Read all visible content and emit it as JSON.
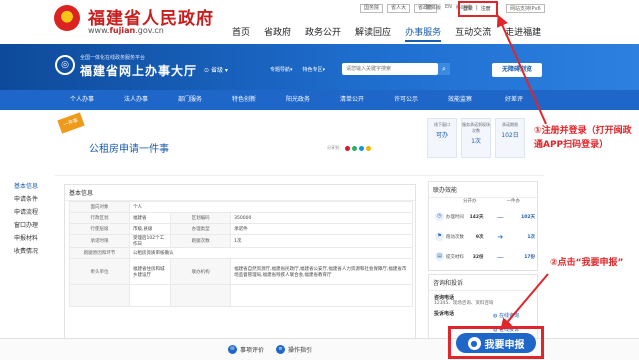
{
  "header": {
    "site_title": "福建省人民政府",
    "site_url_prefix": "www.",
    "site_url_domain": "fujian",
    "site_url_suffix": ".gov.cn",
    "mini_links": [
      "国务院",
      "省人大",
      "省政协"
    ],
    "utility": [
      "繁体版",
      "EN",
      "移动版"
    ],
    "login_label": "登录",
    "register_label": "注册",
    "elder_mode": "网站支持IPv6",
    "nav": [
      "首页",
      "省政府",
      "政务公开",
      "解读回应",
      "办事服务",
      "互动交流",
      "走进福建"
    ],
    "nav_active": 4
  },
  "hall": {
    "subtitle": "全国一体化在线政务服务平台",
    "title": "福建省网上办事大厅",
    "region": "省级",
    "links": [
      "专题导航",
      "特色专区"
    ],
    "search_placeholder": "请您输入关键字搜索",
    "barrier_free": "无障碍浏览"
  },
  "subnav": [
    "个人办事",
    "法人办事",
    "部门服务",
    "特色创新",
    "阳光政务",
    "清单公开",
    "许可公示",
    "效能监察",
    "好差评"
  ],
  "item": {
    "ribbon": "一件事",
    "title": "公租房申请一件事",
    "share_label": "分享到：",
    "stats": [
      {
        "label": "线下窗口",
        "value": "可办"
      },
      {
        "label": "服务承诺到现场次数",
        "value": "1次"
      },
      {
        "label": "承诺期限",
        "value": "102日"
      }
    ]
  },
  "left_menu": [
    "基本信息",
    "申请条件",
    "申请流程",
    "窗口办理",
    "申报材料",
    "收费情况"
  ],
  "left_menu_active": 0,
  "basic_info": {
    "title": "基本信息",
    "rows": [
      {
        "k1": "面向对象",
        "v1": "个人",
        "k2": "",
        "v2": ""
      },
      {
        "k1": "行政区划",
        "v1": "福建省",
        "k2": "区划编码",
        "v2": "350000"
      },
      {
        "k1": "行使层级",
        "v1": "市级,县级",
        "k2": "办理类型",
        "v2": "承诺件"
      },
      {
        "k1": "承诺时限",
        "v1": "受理后102个工作日",
        "k2": "跑腿次数",
        "v2": "1次"
      },
      {
        "k1": "跑腿原因和环节",
        "v1": "公租房资质审核确认",
        "k2": "",
        "v2": ""
      },
      {
        "k1": "牵头单位",
        "v1": "福建省住房和城乡建设厅",
        "k2": "联办机构",
        "v2": "福建省自然资源厅,福建省民政厅,福建省公安厅,福建省人力资源和社会保障厅,福建省市场监督管理局,福建省残疾人联合会,福建省教育厅"
      },
      {
        "k1": "",
        "v1": "",
        "k2": "",
        "v2": ""
      }
    ]
  },
  "effect": {
    "title": "联办效能",
    "col_before": "分开办",
    "col_after": "一件办",
    "rows": [
      {
        "label": "办理时间",
        "before": "142天",
        "after": "102天"
      },
      {
        "label": "跑动次数",
        "before": "9次",
        "after": "1次"
      },
      {
        "label": "提交材料",
        "before": "32份",
        "after": "17份"
      }
    ]
  },
  "consult": {
    "title": "咨询和投诉",
    "phone_label": "咨询电话",
    "phone_text": "12345、现场咨询、资料咨询",
    "complaint_label": "投诉电话",
    "online_label": "在线咨询",
    "online2_label": "在线投诉"
  },
  "bottom": {
    "review_label": "事项评价",
    "guide_label": "操作指引",
    "apply_label": "我要申报"
  },
  "annotations": {
    "note1": "①注册并登录（打开闽政通APP扫码登录）",
    "note2": "②点击“我要申报”"
  },
  "colors": {
    "brand_red": "#c81e1e",
    "primary_blue": "#1e66c7",
    "annotation_red": "#e0262a"
  }
}
